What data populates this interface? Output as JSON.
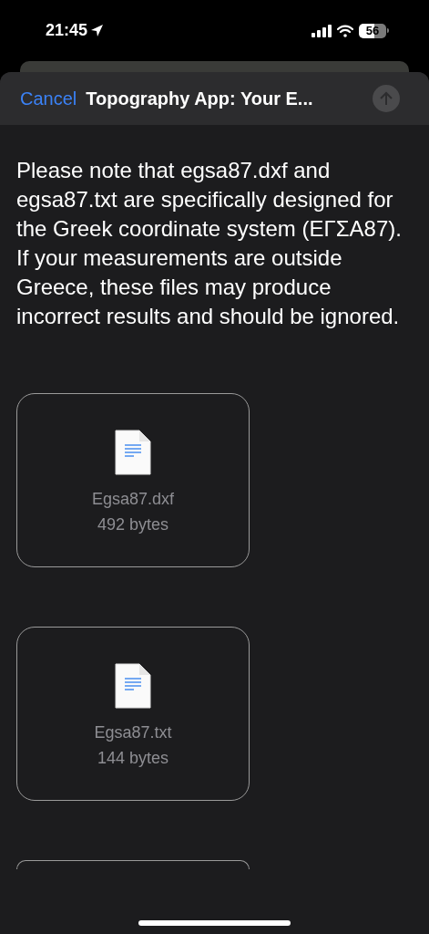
{
  "status_bar": {
    "time": "21:45",
    "battery": "56"
  },
  "sheet": {
    "cancel": "Cancel",
    "title": "Topography App: Your E...",
    "send_disabled": true
  },
  "message": [
    "Please note that egsa87.dxf and egsa87.txt are specifically designed for the Greek coordinate system (ΕΓΣΑ87).",
    "If your measurements are outside Greece, these files may produce incorrect results and should be ignored."
  ],
  "attachments": [
    {
      "kind": "file",
      "name": "Egsa87.dxf",
      "size": "492 bytes"
    },
    {
      "kind": "file",
      "name": "Egsa87.txt",
      "size": "144 bytes"
    },
    {
      "kind": "partial"
    }
  ]
}
